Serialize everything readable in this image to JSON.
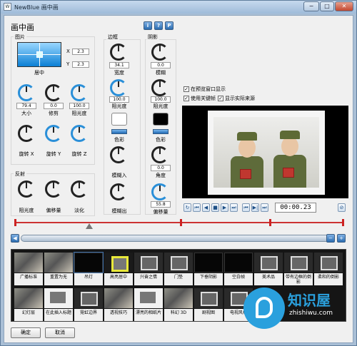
{
  "window": {
    "title": "NewBlue 画中画",
    "app_icon_text": "W",
    "min": "−",
    "max": "□",
    "close": "✕"
  },
  "heading": "画中画",
  "help": {
    "info": "i",
    "help": "?",
    "presets": "P"
  },
  "picture": {
    "group_label": "图片",
    "position_label": "居中",
    "x_label": "X",
    "x_value": "2.3",
    "y_label": "Y",
    "y_value": "2.3",
    "knobs": [
      {
        "value": "79.4",
        "label": "大小"
      },
      {
        "value": "0.0",
        "label": "修剪"
      },
      {
        "value": "100.0",
        "label": "阻光度"
      },
      {
        "value": "",
        "label": "旋转 X"
      },
      {
        "value": "",
        "label": "旋转 Y"
      },
      {
        "value": "",
        "label": "旋转 Z"
      }
    ]
  },
  "reflection": {
    "group_label": "反射",
    "knobs": [
      {
        "label": "阻光度"
      },
      {
        "label": "偏移量"
      },
      {
        "label": "淡化"
      }
    ]
  },
  "border": {
    "group_label": "边框",
    "width_value": "34.1",
    "width_label": "宽度",
    "opacity_value": "100.0",
    "opacity_label": "阻光度",
    "color_label": "色彩",
    "fade_in_label": "模糊入",
    "fade_out_label": "模糊出",
    "color": "#ffffff"
  },
  "shadow": {
    "group_label": "阴影",
    "blur_value": "0.0",
    "blur_label": "模糊",
    "opacity_value": "100.0",
    "opacity_label": "阻光度",
    "color_label": "色彩",
    "angle_value": "0.0",
    "angle_label": "角度",
    "offset_value": "55.8",
    "offset_label": "偏移量",
    "color": "#000000"
  },
  "options": {
    "show_in_preview": "在预览窗口显示",
    "use_keyframes": "使用关键帧",
    "show_source": "显示实际来源"
  },
  "transport": {
    "buttons": [
      "↻",
      "⏮",
      "◀",
      "■",
      "▶",
      "⏭",
      "⏮",
      "▶|",
      "⏭"
    ],
    "timecode": "00:00.23",
    "settings": "⊘"
  },
  "scroll": {
    "left": "◀",
    "right": "▶",
    "minus": "−",
    "plus": "+"
  },
  "presets": [
    {
      "label": "广播标准",
      "style": "photoish"
    },
    {
      "label": "重置为无",
      "style": "photoish"
    },
    {
      "label": "吊灯",
      "style": "dark"
    },
    {
      "label": "高亮居中",
      "style": "yellow"
    },
    {
      "label": "兴奋之情",
      "style": "framed"
    },
    {
      "label": "门垫",
      "style": "framed"
    },
    {
      "label": "下垂阴影",
      "style": "dark"
    },
    {
      "label": "空白帧",
      "style": "dark"
    },
    {
      "label": "美术品",
      "style": "framed"
    },
    {
      "label": "带有边框的倒影",
      "style": "framed"
    },
    {
      "label": "柔和的倒影",
      "style": "framed"
    },
    {
      "label": "幻灯层",
      "style": "photoish"
    },
    {
      "label": "在此插入标题",
      "style": "whiteframe"
    },
    {
      "label": "霓虹边界",
      "style": "framed"
    },
    {
      "label": "透视技巧",
      "style": "photoish"
    },
    {
      "label": "漂亮的相纸片",
      "style": "whiteframe"
    },
    {
      "label": "科幻 3D",
      "style": "photoish"
    },
    {
      "label": "剧视图",
      "style": "framed"
    },
    {
      "label": "电视风格",
      "style": "framed"
    }
  ],
  "buttons": {
    "ok": "确定",
    "cancel": "取消"
  },
  "watermark": {
    "brand": "知识屋",
    "url": "zhishiwu.com"
  }
}
